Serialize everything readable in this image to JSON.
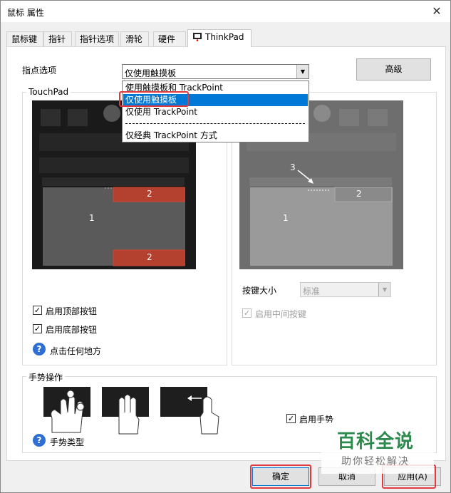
{
  "window": {
    "title": "鼠标 属性",
    "close": "✕"
  },
  "tabs": [
    "鼠标键",
    "指针",
    "指针选项",
    "滑轮",
    "硬件",
    "ThinkPad"
  ],
  "pointing": {
    "label": "指点选项",
    "selected": "仅使用触摸板",
    "options": [
      "使用触摸板和 TrackPoint",
      "仅使用触摸板",
      "仅使用 TrackPoint",
      "仅经典 TrackPoint 方式"
    ],
    "advanced": "高级"
  },
  "touchpad": {
    "group_title": "TouchPad",
    "zone_main": "1",
    "zone_top": "2",
    "zone_bottom": "2",
    "enable_top": "启用顶部按钮",
    "enable_bottom": "启用底部按钮",
    "help": "点击任何地方"
  },
  "trackpoint": {
    "zone_main": "1",
    "zone_right": "2",
    "zone_arrow": "3",
    "button_size_label": "按键大小",
    "button_size_value": "标准",
    "enable_middle": "启用中间按键"
  },
  "gestures": {
    "group_title": "手势操作",
    "enable": "启用手势",
    "types": "手势类型"
  },
  "buttons": {
    "ok": "确定",
    "cancel": "取消",
    "apply": "应用(A)"
  },
  "watermark": {
    "title": "百科全说",
    "subtitle": "助你轻松解决"
  }
}
